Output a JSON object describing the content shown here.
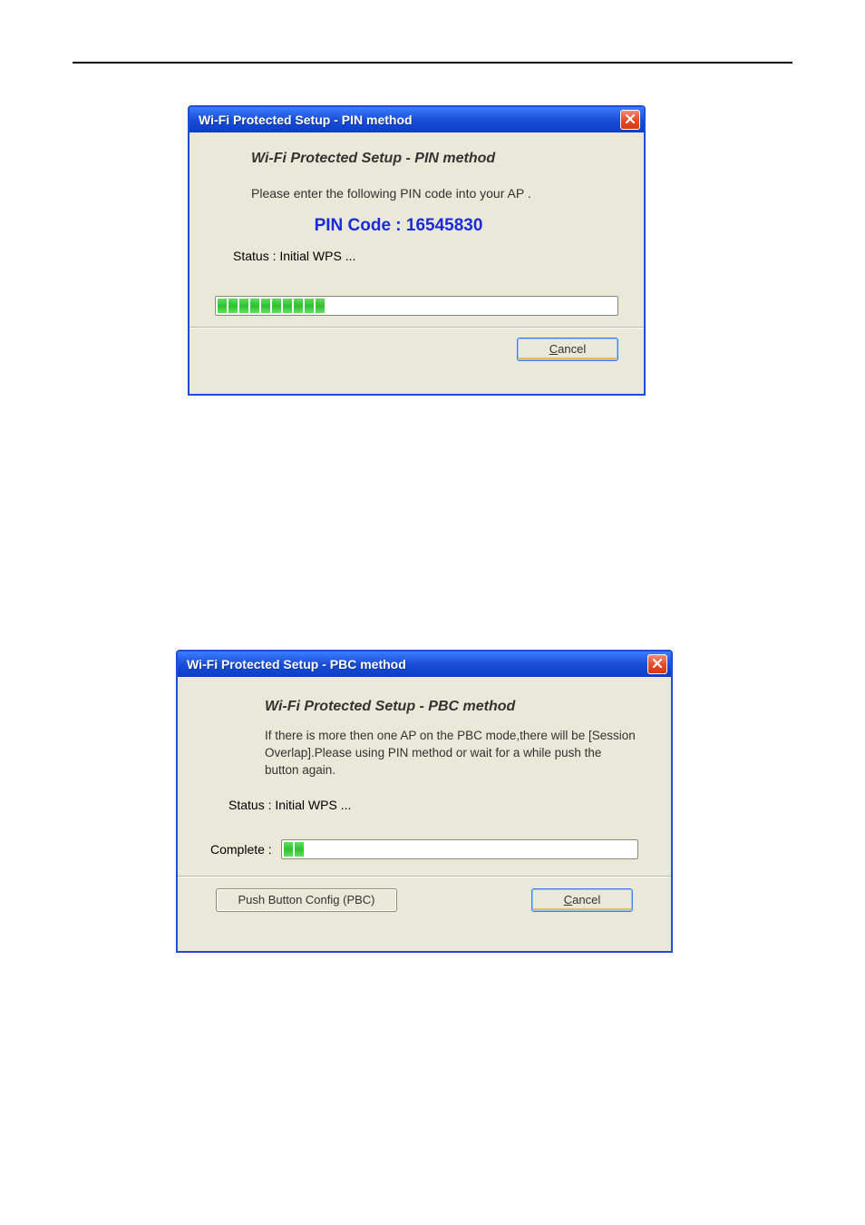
{
  "dialog_pin": {
    "title": "Wi-Fi Protected Setup - PIN method",
    "heading": "Wi-Fi Protected Setup - PIN method",
    "instruction": "Please enter the following PIN code into your AP .",
    "pin_label": "PIN Code :  16545830",
    "status": "Status :  Initial WPS ...",
    "progress_segments": 10,
    "cancel_label": "Cancel"
  },
  "dialog_pbc": {
    "title": "Wi-Fi Protected Setup - PBC method",
    "heading": "Wi-Fi Protected Setup - PBC method",
    "instruction": "If there is more then one AP on the PBC mode,there will be [Session Overlap].Please using PIN method or wait for a while push the button again.",
    "status": "Status : Initial WPS ...",
    "complete_label": "Complete :",
    "progress_segments": 2,
    "pbc_button_label": "Push Button Config (PBC)",
    "cancel_label": "Cancel"
  }
}
